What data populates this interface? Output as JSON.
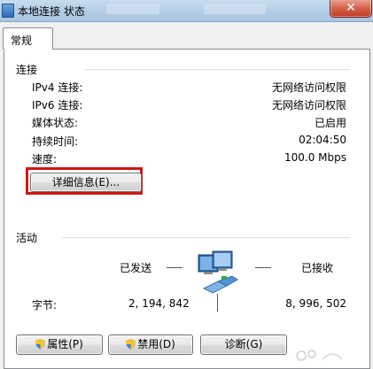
{
  "window": {
    "title": "本地连接 状态",
    "close_glyph": "✕"
  },
  "tabs": [
    {
      "label": "常规",
      "selected": true
    }
  ],
  "connection": {
    "section_title": "连接",
    "rows": [
      {
        "label": "IPv4 连接:",
        "value": "无网络访问权限"
      },
      {
        "label": "IPv6 连接:",
        "value": "无网络访问权限"
      },
      {
        "label": "媒体状态:",
        "value": "已启用"
      },
      {
        "label": "持续时间:",
        "value": "02:04:50"
      },
      {
        "label": "速度:",
        "value": "100.0 Mbps"
      }
    ],
    "details_button": "详细信息(E)..."
  },
  "activity": {
    "section_title": "活动",
    "sent_label": "已发送",
    "received_label": "已接收",
    "bytes_label": "字节:",
    "bytes_sent": "2, 194, 842",
    "bytes_received": "8, 996, 502"
  },
  "buttons": {
    "properties": "属性(P)",
    "disable": "禁用(D)",
    "diagnose": "诊断(G)"
  },
  "colors": {
    "highlight": "#d21515",
    "close_button": "#c2391f",
    "titlebar": "#b3cde6"
  }
}
